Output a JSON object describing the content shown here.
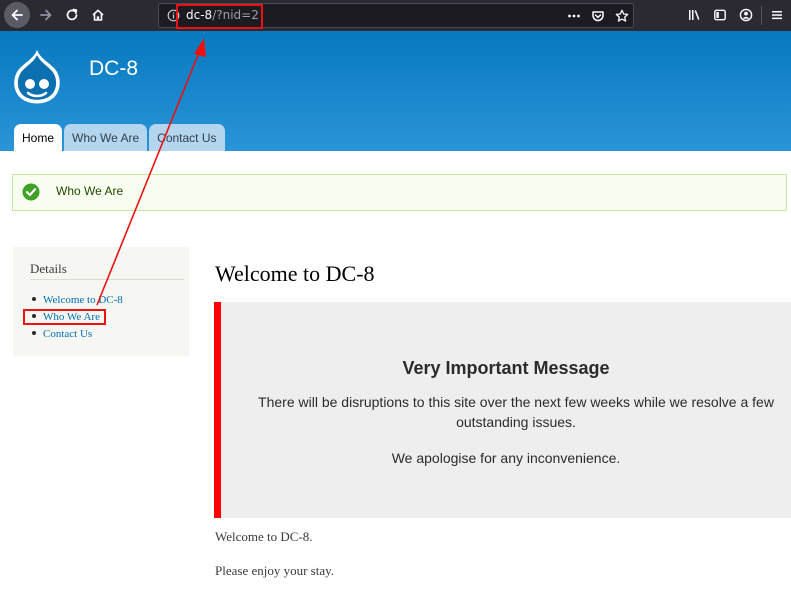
{
  "browser": {
    "url_host": "dc-8",
    "url_path": "/?nid=2",
    "icons": [
      "back-arrow-icon",
      "forward-arrow-icon",
      "reload-icon",
      "home-icon",
      "info-icon",
      "more-dots-icon",
      "pocket-icon",
      "bookmark-star-icon",
      "library-icon",
      "sidebar-icon",
      "account-icon",
      "menu-icon"
    ]
  },
  "site": {
    "name": "DC-8",
    "tabs": [
      {
        "label": "Home",
        "active": true
      },
      {
        "label": "Who We Are",
        "active": false
      },
      {
        "label": "Contact Us",
        "active": false
      }
    ]
  },
  "status": {
    "message": "Who We Are"
  },
  "sidebar": {
    "title": "Details",
    "items": [
      {
        "label": "Welcome to DC-8"
      },
      {
        "label": "Who We Are"
      },
      {
        "label": "Contact Us"
      }
    ]
  },
  "main": {
    "title": "Welcome to DC-8",
    "notice": {
      "heading": "Very Important Message",
      "paragraph1": "There will be disruptions to this site over the next few weeks while we resolve a few outstanding issues.",
      "paragraph2": "We apologise for any inconvenience."
    },
    "body": [
      "Welcome to DC-8.",
      "Please enjoy your stay."
    ]
  },
  "colors": {
    "header_top": "#0779bf",
    "header_bottom": "#2a94d8",
    "link": "#0071b3",
    "notice_accent": "#ff0000",
    "annotation": "#ee1111",
    "status_ok": "#3fa128"
  }
}
